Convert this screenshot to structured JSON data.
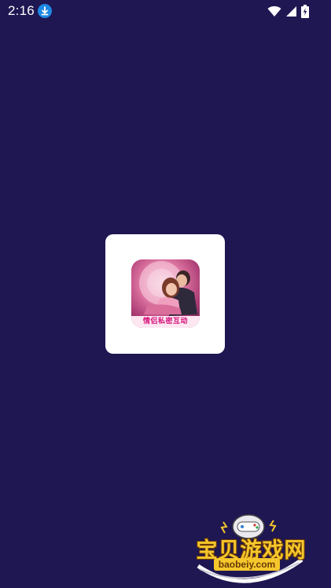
{
  "status_bar": {
    "time": "2:16",
    "icons": [
      "download-icon",
      "wifi-icon",
      "cell-signal-icon",
      "battery-charging-icon"
    ]
  },
  "splash": {
    "app_icon_name": "app-logo",
    "app_icon_text": "情侣私密互动"
  },
  "watermark": {
    "title": "宝贝游戏网",
    "url": "baobeiy.com"
  },
  "colors": {
    "background": "#1f1752",
    "card": "#ffffff",
    "accent_blue": "#1e88e5",
    "watermark_gold": "#f5c72c"
  }
}
